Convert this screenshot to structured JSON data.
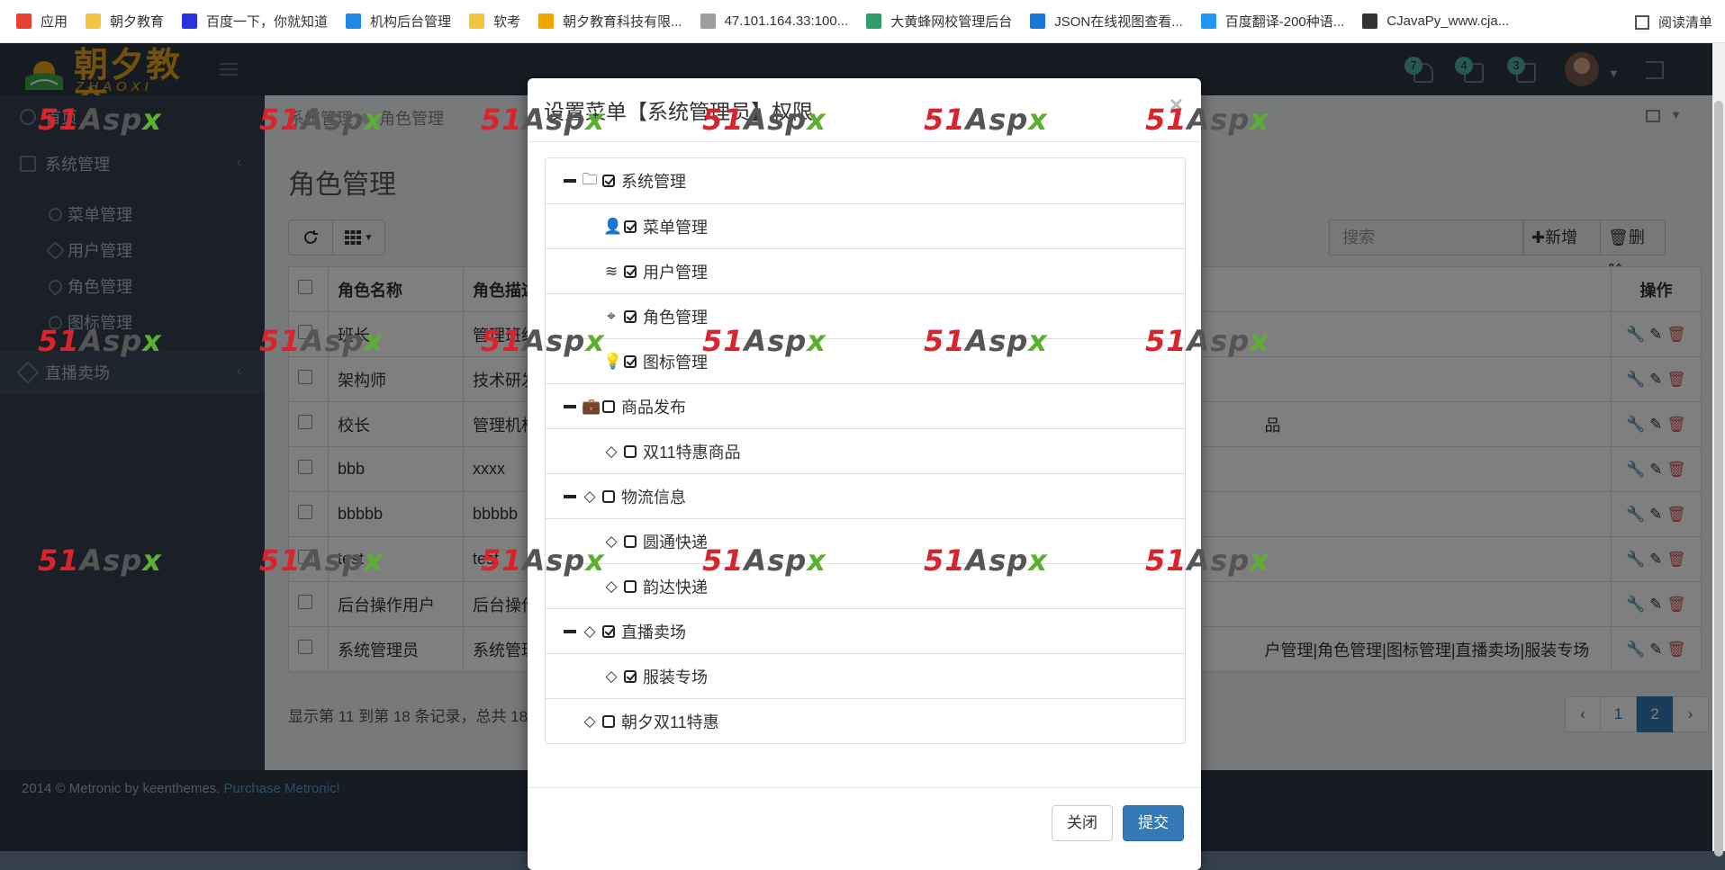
{
  "bookmarks": [
    {
      "label": "应用",
      "icon": "apps-grid-icon",
      "color": "#e94235"
    },
    {
      "label": "朝夕教育",
      "icon": "folder-icon",
      "color": "#f5c542"
    },
    {
      "label": "百度一下，你就知道",
      "icon": "baidu-paw-icon",
      "color": "#2932e1"
    },
    {
      "label": "机构后台管理",
      "icon": "diamond-icon",
      "color": "#1e88e5"
    },
    {
      "label": "软考",
      "icon": "folder-icon",
      "color": "#f5c542"
    },
    {
      "label": "朝夕教育科技有限...",
      "icon": "bulb-icon",
      "color": "#f0a500"
    },
    {
      "label": "47.101.164.33:100...",
      "icon": "page-icon",
      "color": "#9e9e9e"
    },
    {
      "label": "大黄蜂网校管理后台",
      "icon": "bee-icon",
      "color": "#2e9e6a"
    },
    {
      "label": "JSON在线视图查看...",
      "icon": "json-b-icon",
      "color": "#1976d2"
    },
    {
      "label": "百度翻译-200种语...",
      "icon": "translate-icon",
      "color": "#2196f3"
    },
    {
      "label": "CJavaPy_www.cja...",
      "icon": "cjavapy-icon",
      "color": "#333333"
    }
  ],
  "reading_list": "阅读清单",
  "header": {
    "logo_text": "朝夕教育",
    "logo_sub": "ZHAOXI EDU",
    "badges": [
      "7",
      "4",
      "3"
    ]
  },
  "sidebar": {
    "home": "首页",
    "system": "系统管理",
    "sub": [
      "菜单管理",
      "用户管理",
      "角色管理",
      "图标管理"
    ],
    "live": "直播卖场"
  },
  "breadcrumb": [
    "系统管理",
    "角色管理"
  ],
  "page_title": "角色管理",
  "toolbar": {
    "search_placeholder": "搜索",
    "add_label": "新增",
    "delete_label": "删除"
  },
  "table": {
    "columns": [
      "角色名称",
      "角色描述",
      "操作"
    ],
    "rows": [
      {
        "name": "班长",
        "desc": "管理班级",
        "extra": ""
      },
      {
        "name": "架构师",
        "desc": "技术研发",
        "extra": ""
      },
      {
        "name": "校长",
        "desc": "管理机构",
        "extra": "品"
      },
      {
        "name": "bbb",
        "desc": "xxxx",
        "extra": ""
      },
      {
        "name": "bbbbb",
        "desc": "bbbbb",
        "extra": ""
      },
      {
        "name": "test",
        "desc": "test",
        "extra": ""
      },
      {
        "name": "后台操作用户",
        "desc": "后台操作",
        "extra": ""
      },
      {
        "name": "系统管理员",
        "desc": "系统管理",
        "extra": "户管理|角色管理|图标管理|直播卖场|服装专场"
      }
    ]
  },
  "pager": {
    "info": "显示第 11 到第 18 条记录，总共 18",
    "prev": "‹",
    "pages": [
      "1",
      "2"
    ],
    "next": "›",
    "active": "2"
  },
  "footer": {
    "text": "2014 © Metronic by keenthemes.",
    "link": "Purchase Metronic!"
  },
  "modal": {
    "title": "设置菜单【系统管理员】权限",
    "close": "×",
    "tree": [
      {
        "label": "系统管理",
        "level": 0,
        "collapsible": true,
        "checked": true,
        "icon": "folder-icon"
      },
      {
        "label": "菜单管理",
        "level": 1,
        "collapsible": false,
        "checked": true,
        "icon": "user-icon"
      },
      {
        "label": "用户管理",
        "level": 1,
        "collapsible": false,
        "checked": true,
        "icon": "layers-icon"
      },
      {
        "label": "角色管理",
        "level": 1,
        "collapsible": false,
        "checked": true,
        "icon": "map-pin-icon"
      },
      {
        "label": "图标管理",
        "level": 1,
        "collapsible": false,
        "checked": true,
        "icon": "bulb-icon"
      },
      {
        "label": "商品发布",
        "level": 0,
        "collapsible": true,
        "checked": false,
        "icon": "briefcase-icon"
      },
      {
        "label": "双11特惠商品",
        "level": 1,
        "collapsible": false,
        "checked": false,
        "icon": "diamond-icon"
      },
      {
        "label": "物流信息",
        "level": 0,
        "collapsible": true,
        "checked": false,
        "icon": "diamond-icon"
      },
      {
        "label": "圆通快递",
        "level": 1,
        "collapsible": false,
        "checked": false,
        "icon": "diamond-icon"
      },
      {
        "label": "韵达快递",
        "level": 1,
        "collapsible": false,
        "checked": false,
        "icon": "diamond-icon"
      },
      {
        "label": "直播卖场",
        "level": 0,
        "collapsible": true,
        "checked": true,
        "icon": "diamond-icon"
      },
      {
        "label": "服装专场",
        "level": 1,
        "collapsible": false,
        "checked": true,
        "icon": "diamond-icon"
      },
      {
        "label": "朝夕双11特惠",
        "level": 0,
        "collapsible": false,
        "checked": false,
        "icon": "diamond-icon"
      }
    ],
    "close_button": "关闭",
    "submit_button": "提交"
  },
  "watermark": {
    "a": "51",
    "b": "Asp",
    "c": "x"
  }
}
